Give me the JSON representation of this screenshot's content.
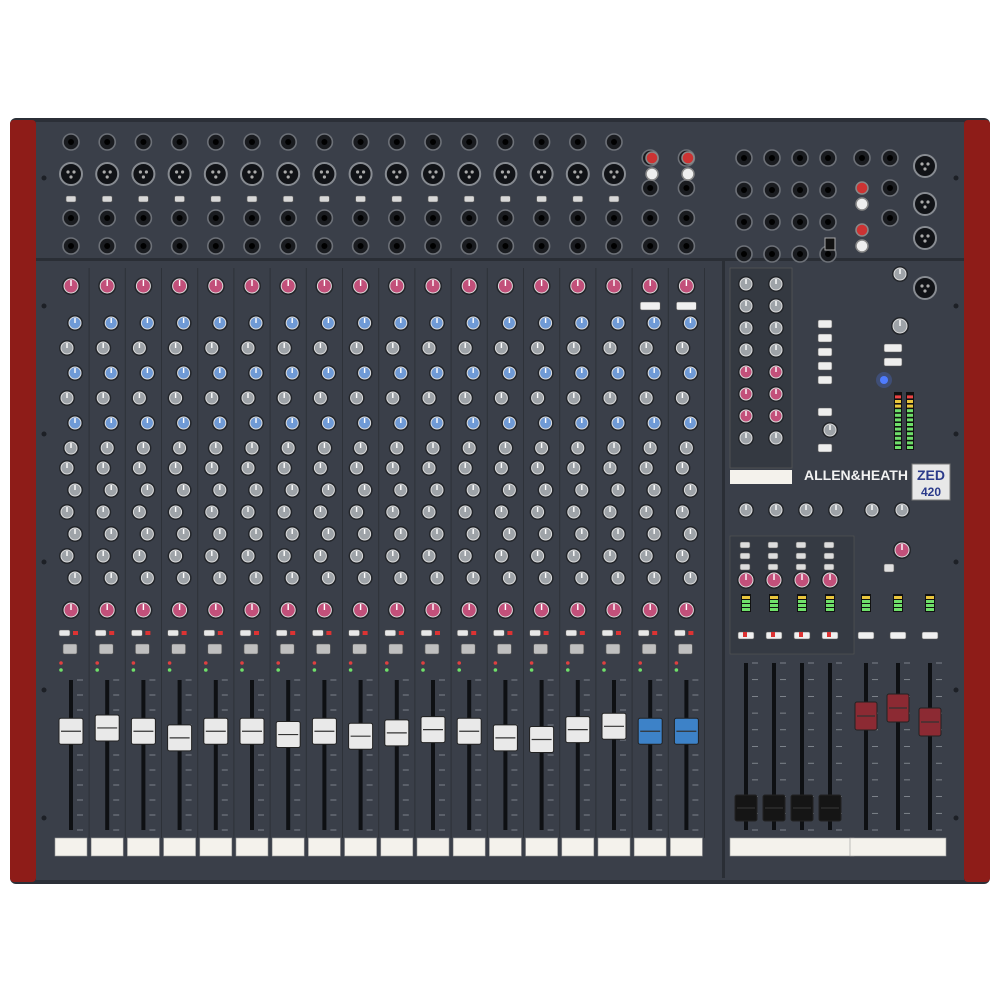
{
  "brand": {
    "logo": "ALLEN&HEATH",
    "model_line1": "ZED",
    "model_line2": "420"
  },
  "colors": {
    "panel": "#3a3f49",
    "panel_dark": "#2b2f37",
    "side_cheek": "#8e1c18",
    "knob_pink": "#c2507a",
    "knob_blue": "#6f9ad6",
    "knob_grey": "#9ea3a8",
    "fader_white": "#e9e9e9",
    "fader_blue": "#3d82c8",
    "fader_red": "#8c2a33",
    "fader_black": "#151515",
    "led_green": "#6fe06a",
    "led_blue": "#4f7dff"
  },
  "layout_counts": {
    "mono_channels": 16,
    "stereo_channels": 2,
    "group_faders": 4,
    "master_faders": 3
  },
  "icons": {
    "xlr_input": "xlr-input-icon",
    "jack_input": "jack-input-icon",
    "rca_input": "rca-input-icon",
    "usb_port": "usb-port-icon",
    "rotary_knob": "rotary-knob-icon",
    "fader_cap": "fader-cap-icon",
    "push_button": "push-button-icon",
    "level_meter": "level-meter-icon"
  }
}
